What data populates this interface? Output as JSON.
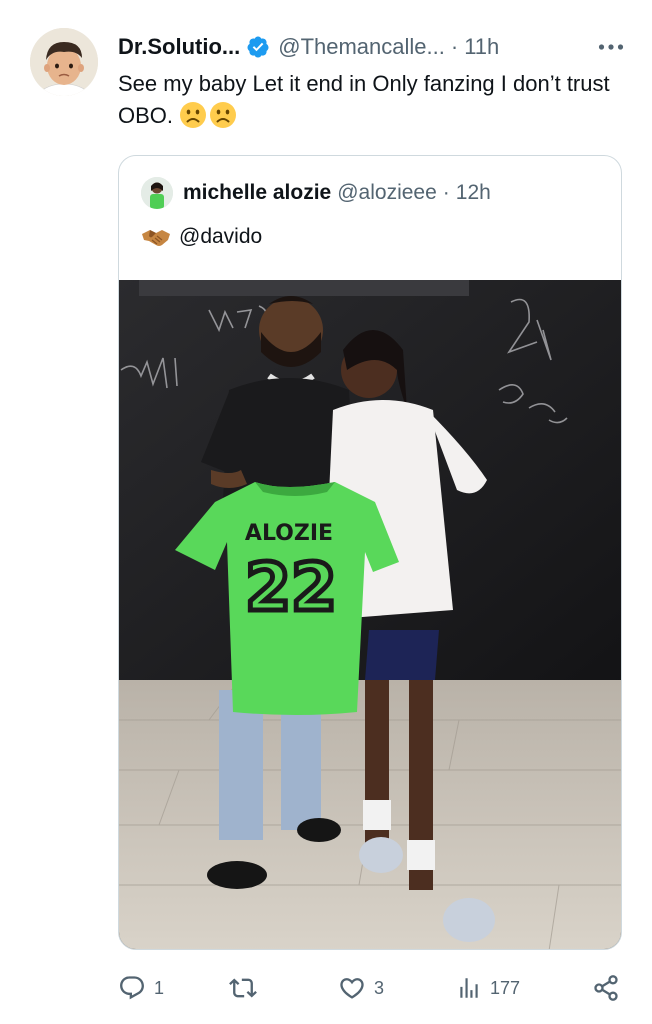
{
  "author": {
    "display_name": "Dr.Solutio...",
    "handle": "@Themancalle...",
    "separator": "·",
    "time": "11h",
    "verified": true
  },
  "tweet": {
    "text": "See my baby Let it end in Only fanzing I don’t trust OBO.",
    "emojis": [
      "frowning-face",
      "frowning-face"
    ]
  },
  "quoted": {
    "display_name": "michelle alozie",
    "handle": "@alozieee",
    "separator": "·",
    "time": "12h",
    "text": "@davido",
    "emoji": "handshake",
    "photo": {
      "jersey_name": "ALOZIE",
      "jersey_number": "22"
    }
  },
  "actions": {
    "replies": "1",
    "retweets": "",
    "likes": "3",
    "views": "177"
  },
  "colors": {
    "text": "#0f1419",
    "muted": "#536471",
    "border": "#cfd9de",
    "verified": "#1d9bf0",
    "jersey": "#59d85a"
  }
}
